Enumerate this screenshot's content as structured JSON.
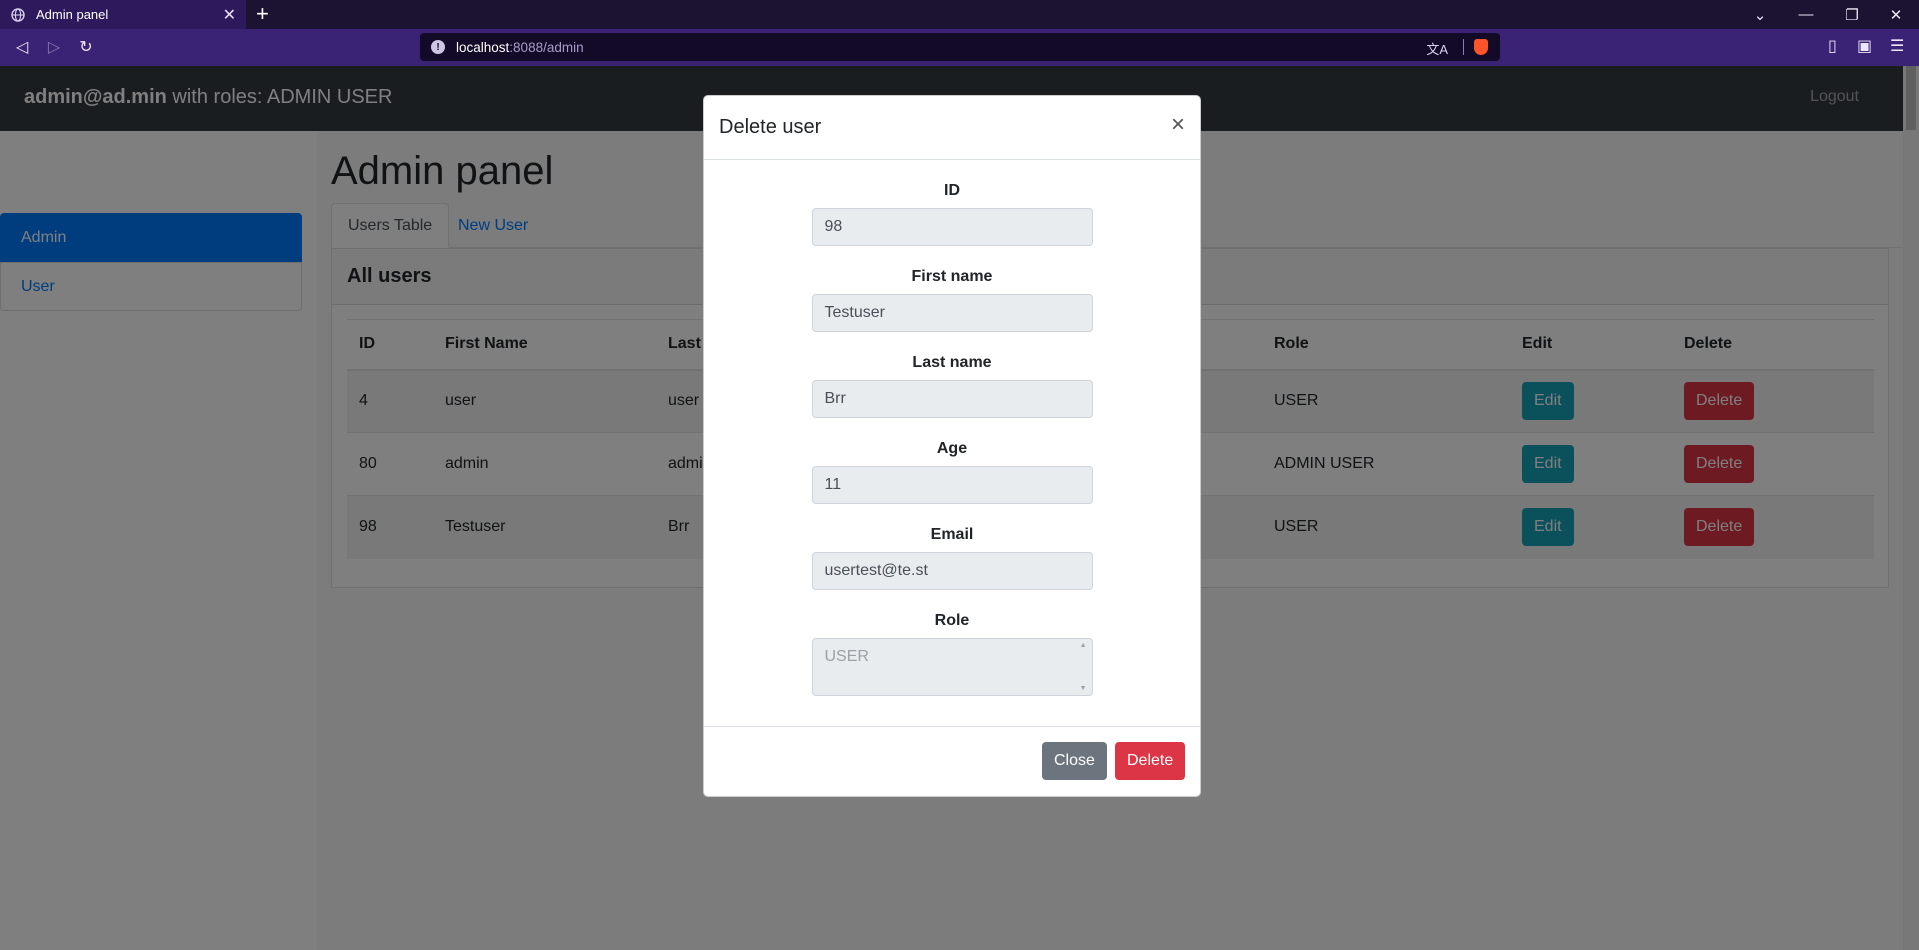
{
  "browser": {
    "tab_title": "Admin panel",
    "new_tab": "+",
    "url_host": "localhost",
    "url_rest": ":8088/admin",
    "window_controls": [
      "chevron-down-icon",
      "minimize-icon",
      "restore-icon",
      "close-icon"
    ]
  },
  "navbar": {
    "user_email": "admin@ad.min",
    "roles_text": " with roles: ADMIN USER",
    "logout_label": "Logout"
  },
  "sidebar": {
    "items": [
      {
        "label": "Admin",
        "active": true
      },
      {
        "label": "User",
        "active": false
      }
    ]
  },
  "main": {
    "title": "Admin panel",
    "tabs": [
      {
        "label": "Users Table",
        "active": true
      },
      {
        "label": "New User",
        "active": false
      }
    ],
    "card_title": "All users",
    "table": {
      "headers": [
        "ID",
        "First Name",
        "Last",
        "Role",
        "Edit",
        "Delete"
      ],
      "rows": [
        {
          "id": "4",
          "first": "user",
          "last": "user",
          "role": "USER"
        },
        {
          "id": "80",
          "first": "admin",
          "last": "admi",
          "role": "ADMIN USER"
        },
        {
          "id": "98",
          "first": "Testuser",
          "last": "Brr",
          "role": "USER"
        }
      ],
      "edit_label": "Edit",
      "delete_label": "Delete"
    }
  },
  "modal": {
    "title": "Delete user",
    "close_x": "×",
    "fields": [
      {
        "label": "ID",
        "value": "98"
      },
      {
        "label": "First name",
        "value": "Testuser"
      },
      {
        "label": "Last name",
        "value": "Brr"
      },
      {
        "label": "Age",
        "value": "11"
      },
      {
        "label": "Email",
        "value": "usertest@te.st"
      },
      {
        "label": "Role",
        "value": "USER"
      }
    ],
    "close_label": "Close",
    "delete_label": "Delete"
  },
  "colors": {
    "primary": "#007bff",
    "info": "#17a2b8",
    "danger": "#dc3545",
    "secondary": "#6c757d",
    "navbar": "#343a40"
  }
}
